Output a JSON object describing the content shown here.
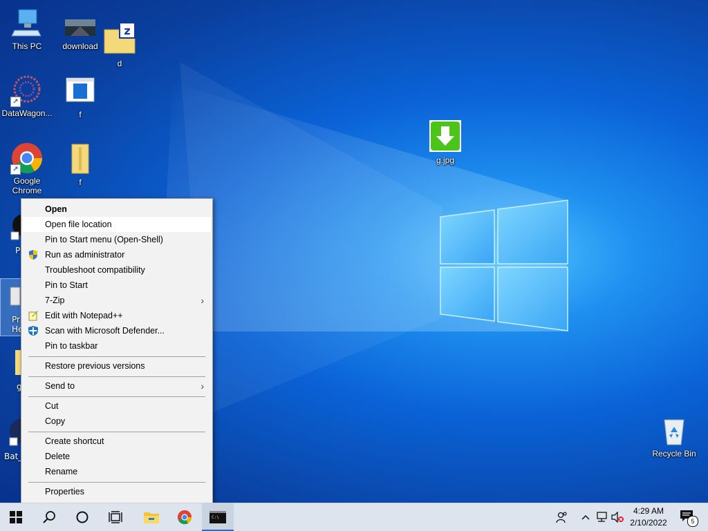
{
  "desktop": {
    "icons": [
      {
        "label": "This PC"
      },
      {
        "label": "download"
      },
      {
        "label": "d"
      },
      {
        "label": "DataWagon..."
      },
      {
        "label": "f"
      },
      {
        "label": "Google Chrome"
      },
      {
        "label": "f"
      },
      {
        "label": "g.jpg"
      },
      {
        "label": "Recycle Bin"
      }
    ],
    "partial_labels": [
      "P",
      "Pr",
      "He",
      "g",
      "Bat_"
    ]
  },
  "context_menu": {
    "items": [
      "Open",
      "Open file location",
      "Pin to Start menu (Open-Shell)",
      "Run as administrator",
      "Troubleshoot compatibility",
      "Pin to Start",
      "7-Zip",
      "Edit with Notepad++",
      "Scan with Microsoft Defender...",
      "Pin to taskbar",
      "Restore previous versions",
      "Send to",
      "Cut",
      "Copy",
      "Create shortcut",
      "Delete",
      "Rename",
      "Properties"
    ],
    "submenu_arrow": "›"
  },
  "taskbar": {
    "time": "4:29 AM",
    "date": "2/10/2022",
    "notification_count": "5",
    "icons": [
      "windows-start-icon",
      "search-icon",
      "cortana-icon",
      "task-view-icon",
      "file-explorer-icon",
      "chrome-icon",
      "terminal-icon"
    ]
  },
  "colors": {
    "desktop_blue": "#0a62d6",
    "menu_bg": "#f2f2f2",
    "taskbar_bg": "#dde4ee",
    "active_underline": "#2b6cd4"
  }
}
